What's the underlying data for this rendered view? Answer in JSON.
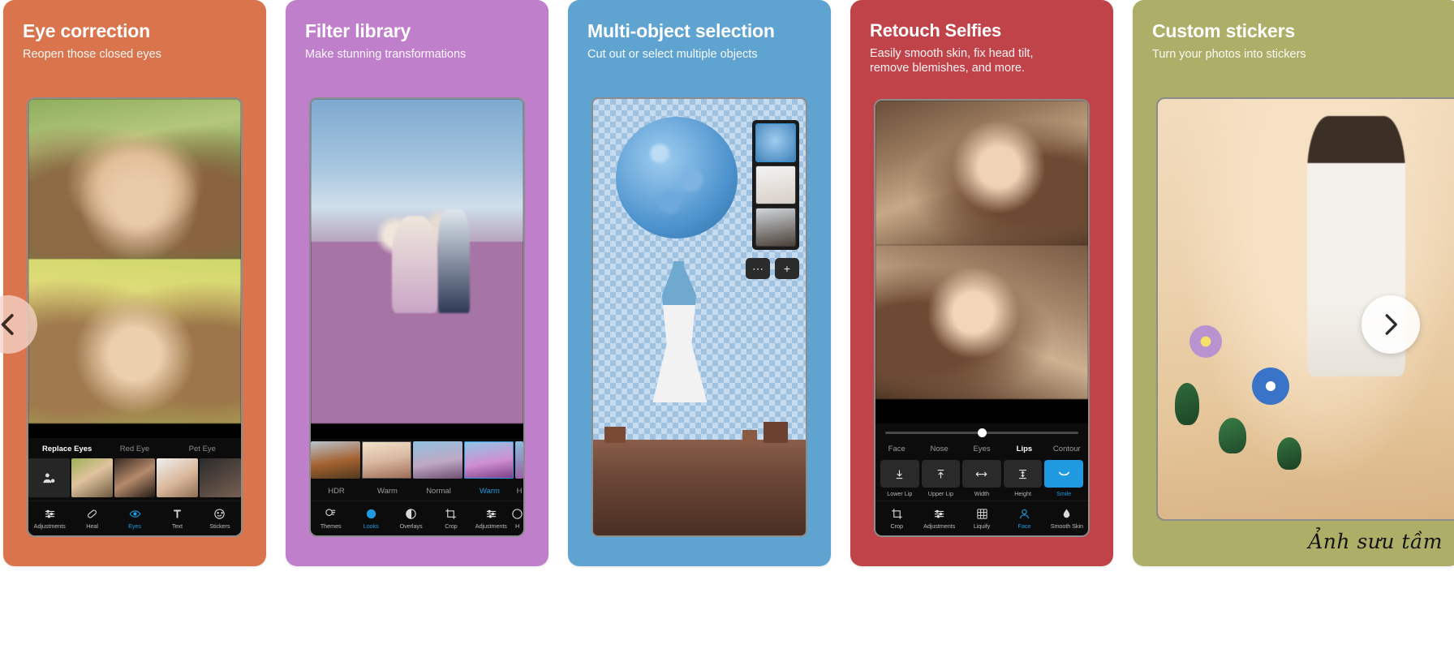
{
  "carousel": {
    "prev_label": "Previous",
    "next_label": "Next",
    "prev_icon": "chevron-left-icon",
    "next_icon": "chevron-right-icon"
  },
  "watermark": "Ảnh sưu tầm",
  "cards": [
    {
      "id": "eye-correction",
      "title": "Eye correction",
      "subtitle": "Reopen those closed eyes",
      "bg": "#d9744d",
      "editor": {
        "mode_tabs": [
          {
            "label": "Replace Eyes",
            "active": true
          },
          {
            "label": "Red Eye",
            "active": false
          },
          {
            "label": "Pet Eye",
            "active": false
          }
        ],
        "nav": [
          {
            "label": "Adjustments",
            "icon": "sliders-icon",
            "active": false
          },
          {
            "label": "Heal",
            "icon": "bandage-icon",
            "active": false
          },
          {
            "label": "Eyes",
            "icon": "eye-icon",
            "active": true
          },
          {
            "label": "Text",
            "icon": "text-icon",
            "active": false
          },
          {
            "label": "Stickers",
            "icon": "sticker-icon",
            "active": false
          }
        ]
      }
    },
    {
      "id": "filter-library",
      "title": "Filter library",
      "subtitle": "Make stunning transformations",
      "bg": "#c07fcb",
      "editor": {
        "filters": [
          {
            "label": "HDR",
            "active": false
          },
          {
            "label": "Warm",
            "active": false
          },
          {
            "label": "Normal",
            "active": false
          },
          {
            "label": "Warm",
            "active": true
          },
          {
            "label": "H",
            "active": false
          }
        ],
        "nav": [
          {
            "label": "Themes",
            "icon": "themes-icon",
            "active": false
          },
          {
            "label": "Looks",
            "icon": "looks-icon",
            "active": true
          },
          {
            "label": "Overlays",
            "icon": "overlays-icon",
            "active": false
          },
          {
            "label": "Crop",
            "icon": "crop-icon",
            "active": false
          },
          {
            "label": "Adjustments",
            "icon": "sliders-icon",
            "active": false
          },
          {
            "label": "H",
            "icon": "more-icon",
            "active": false
          }
        ]
      }
    },
    {
      "id": "multi-object-selection",
      "title": "Multi-object selection",
      "subtitle": "Cut out or select multiple objects",
      "bg": "#5fa3d0",
      "editor": {
        "layer_count": 3,
        "buttons": [
          {
            "label": "⋯",
            "name": "layer-more-button"
          },
          {
            "label": "+",
            "name": "layer-add-button"
          }
        ]
      }
    },
    {
      "id": "retouch-selfies",
      "title": "Retouch Selfies",
      "subtitle": "Easily smooth skin, fix head tilt,\nremove blemishes, and more.",
      "bg": "#c0434a",
      "editor": {
        "slider_value": 48,
        "part_tabs": [
          {
            "label": "Face",
            "active": false
          },
          {
            "label": "Nose",
            "active": false
          },
          {
            "label": "Eyes",
            "active": false
          },
          {
            "label": "Lips",
            "active": true
          },
          {
            "label": "Contour",
            "active": false
          }
        ],
        "tools": [
          {
            "label": "Lower Lip",
            "icon": "lower-lip-icon",
            "active": false
          },
          {
            "label": "Upper Lip",
            "icon": "upper-lip-icon",
            "active": false
          },
          {
            "label": "Width",
            "icon": "width-icon",
            "active": false
          },
          {
            "label": "Height",
            "icon": "height-icon",
            "active": false
          },
          {
            "label": "Smile",
            "icon": "smile-icon",
            "active": true
          }
        ],
        "nav": [
          {
            "label": "Crop",
            "icon": "crop-icon",
            "active": false
          },
          {
            "label": "Adjustments",
            "icon": "sliders-icon",
            "active": false
          },
          {
            "label": "Liquify",
            "icon": "liquify-icon",
            "active": false
          },
          {
            "label": "Face",
            "icon": "face-icon",
            "active": true
          },
          {
            "label": "Smooth Skin",
            "icon": "droplet-icon",
            "active": false
          }
        ]
      }
    },
    {
      "id": "custom-stickers",
      "title": "Custom stickers",
      "subtitle": "Turn your photos into stickers",
      "bg": "#adae68",
      "editor": {}
    }
  ]
}
